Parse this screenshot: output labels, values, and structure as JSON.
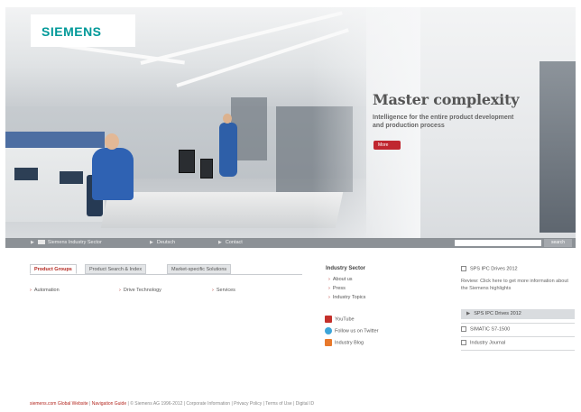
{
  "brand": {
    "logo_text": "SIEMENS",
    "color": "#009999"
  },
  "hero": {
    "headline": "Master complexity",
    "subline": "Intelligence for the entire product development and production process",
    "more_label": "More"
  },
  "navbar": {
    "items": [
      {
        "label": "Siemens Industry Sector"
      },
      {
        "label": "Deutsch"
      },
      {
        "label": "Contact"
      }
    ],
    "search_placeholder": "",
    "search_button": "search"
  },
  "tabs": [
    {
      "label": "Product Groups",
      "active": true
    },
    {
      "label": "Product Search & Index",
      "active": false
    },
    {
      "label": "Market-specific Solutions",
      "active": false
    }
  ],
  "product_links": [
    {
      "label": "Automation"
    },
    {
      "label": "Drive Technology"
    },
    {
      "label": "Services"
    }
  ],
  "industry_sector": {
    "title": "Industry Sector",
    "links": [
      {
        "label": "About us"
      },
      {
        "label": "Press"
      },
      {
        "label": "Industry Topics"
      }
    ],
    "social": [
      {
        "label": "YouTube",
        "icon": "youtube-icon"
      },
      {
        "label": "Follow us on Twitter",
        "icon": "twitter-icon"
      },
      {
        "label": "Industry Blog",
        "icon": "blog-icon"
      }
    ]
  },
  "sidebar": {
    "item1": "SPS IPC Drives 2012",
    "text": "Review: Click here to get more information about the Siemens highlights",
    "bar1": "SPS IPC Drives 2012",
    "item2": "SIMATIC S7-1500",
    "item3": "Industry Journal"
  },
  "footer": {
    "global": "siemens.com Global Website",
    "nav_guide": "Navigation Guide",
    "rest": "| © Siemens AG 1996-2012 | Corporate Information | Privacy Policy | Terms of Use | Digital ID"
  },
  "colors": {
    "accent": "#b3261e",
    "nav_bar": "#8c9196",
    "worker_blue": "#2f62b3"
  }
}
